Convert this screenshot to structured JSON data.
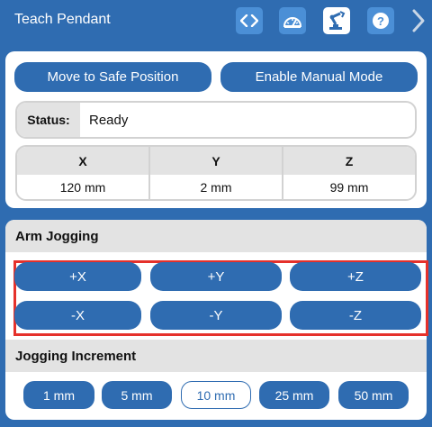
{
  "header": {
    "title": "Teach Pendant",
    "icons": [
      "code-icon",
      "dashboard-gauge-icon",
      "robot-arm-icon",
      "help-icon"
    ],
    "active_icon": "robot-arm-icon",
    "next_icon": "chevron-right-icon"
  },
  "actions": {
    "safe_position": "Move to Safe Position",
    "manual_mode": "Enable Manual Mode"
  },
  "status": {
    "label": "Status:",
    "value": "Ready"
  },
  "coordinates": {
    "x_label": "X",
    "x_value": "120 mm",
    "y_label": "Y",
    "y_value": "2 mm",
    "z_label": "Z",
    "z_value": "99 mm"
  },
  "jogging": {
    "title": "Arm Jogging",
    "plus_x": "+X",
    "plus_y": "+Y",
    "plus_z": "+Z",
    "minus_x": "-X",
    "minus_y": "-Y",
    "minus_z": "-Z"
  },
  "increment": {
    "title": "Jogging Increment",
    "options": [
      "1 mm",
      "5 mm",
      "10 mm",
      "25 mm",
      "50 mm"
    ],
    "selected": "10 mm"
  },
  "colors": {
    "primary": "#2f6cb1",
    "highlight_frame": "#e5312b",
    "panel_header": "#e3e3e3"
  }
}
